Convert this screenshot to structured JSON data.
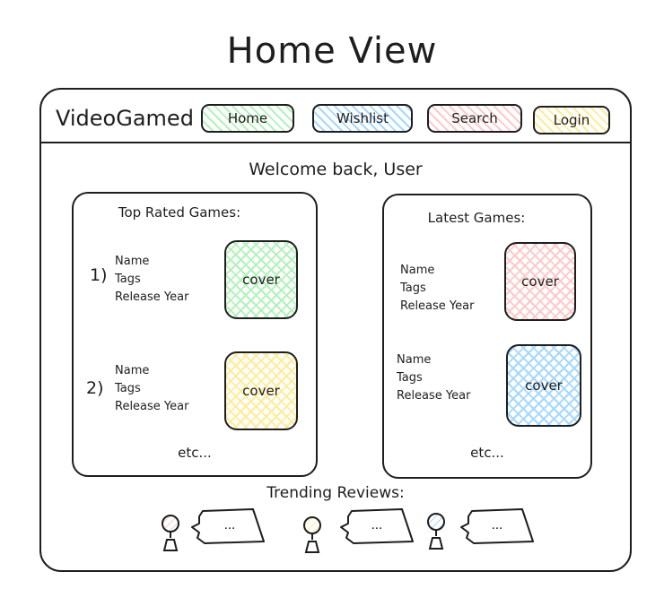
{
  "page": {
    "title": "Home View"
  },
  "navbar": {
    "brand": "VideoGamed",
    "buttons": [
      {
        "label": "Home",
        "color": "#b2f2bb"
      },
      {
        "label": "Wishlist",
        "color": "#a5d8ff"
      },
      {
        "label": "Search",
        "color": "#ffc9c9"
      },
      {
        "label": "Login",
        "color": "#ffec99"
      }
    ]
  },
  "main": {
    "welcome": "Welcome back, User",
    "top_rated": {
      "title": "Top Rated Games:",
      "items": [
        {
          "rank": "1)",
          "name": "Name",
          "tags": "Tags",
          "year": "Release Year",
          "cover": "cover",
          "color": "#b2f2bb"
        },
        {
          "rank": "2)",
          "name": "Name",
          "tags": "Tags",
          "year": "Release Year",
          "cover": "cover",
          "color": "#ffec99"
        }
      ],
      "more": "etc..."
    },
    "latest": {
      "title": "Latest Games:",
      "items": [
        {
          "name": "Name",
          "tags": "Tags",
          "year": "Release Year",
          "cover": "cover",
          "color": "#ffc9c9"
        },
        {
          "name": "Name",
          "tags": "Tags",
          "year": "Release Year",
          "cover": "cover",
          "color": "#a5d8ff"
        }
      ],
      "more": "etc..."
    },
    "trending": {
      "title": "Trending Reviews:",
      "reviews": [
        {
          "avatar_color": "#ffc9c9",
          "text": "..."
        },
        {
          "avatar_color": "#ffec99",
          "text": "..."
        },
        {
          "avatar_color": "#a5d8ff",
          "text": "..."
        }
      ]
    }
  }
}
